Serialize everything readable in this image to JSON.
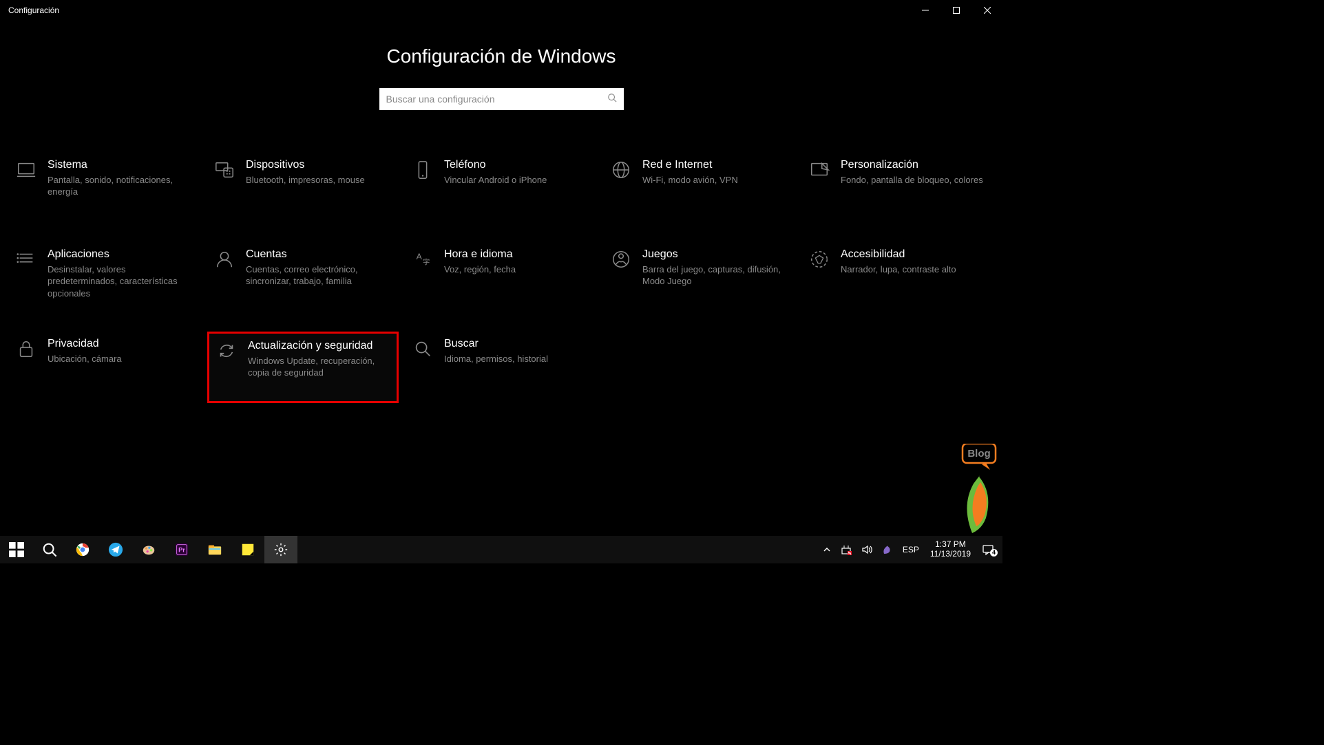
{
  "window": {
    "title": "Configuración"
  },
  "page": {
    "heading": "Configuración de Windows",
    "search_placeholder": "Buscar una configuración"
  },
  "tiles": [
    {
      "id": "sistema",
      "title": "Sistema",
      "desc": "Pantalla, sonido, notificaciones, energía",
      "highlighted": false
    },
    {
      "id": "dispositivos",
      "title": "Dispositivos",
      "desc": "Bluetooth, impresoras, mouse",
      "highlighted": false
    },
    {
      "id": "telefono",
      "title": "Teléfono",
      "desc": "Vincular Android o iPhone",
      "highlighted": false
    },
    {
      "id": "red",
      "title": "Red e Internet",
      "desc": "Wi-Fi, modo avión, VPN",
      "highlighted": false
    },
    {
      "id": "personalizacion",
      "title": "Personalización",
      "desc": "Fondo, pantalla de bloqueo, colores",
      "highlighted": false
    },
    {
      "id": "aplicaciones",
      "title": "Aplicaciones",
      "desc": "Desinstalar, valores predeterminados, características opcionales",
      "highlighted": false
    },
    {
      "id": "cuentas",
      "title": "Cuentas",
      "desc": "Cuentas, correo electrónico, sincronizar, trabajo, familia",
      "highlighted": false
    },
    {
      "id": "hora",
      "title": "Hora e idioma",
      "desc": "Voz, región, fecha",
      "highlighted": false
    },
    {
      "id": "juegos",
      "title": "Juegos",
      "desc": "Barra del juego, capturas, difusión, Modo Juego",
      "highlighted": false
    },
    {
      "id": "accesibilidad",
      "title": "Accesibilidad",
      "desc": "Narrador, lupa, contraste alto",
      "highlighted": false
    },
    {
      "id": "privacidad",
      "title": "Privacidad",
      "desc": "Ubicación, cámara",
      "highlighted": false
    },
    {
      "id": "actualizacion",
      "title": "Actualización y seguridad",
      "desc": "Windows Update, recuperación, copia de seguridad",
      "highlighted": true
    },
    {
      "id": "buscar",
      "title": "Buscar",
      "desc": "Idioma, permisos, historial",
      "highlighted": false
    }
  ],
  "taskbar": {
    "language": "ESP",
    "time": "1:37 PM",
    "date": "11/13/2019",
    "notification_count": "4"
  }
}
